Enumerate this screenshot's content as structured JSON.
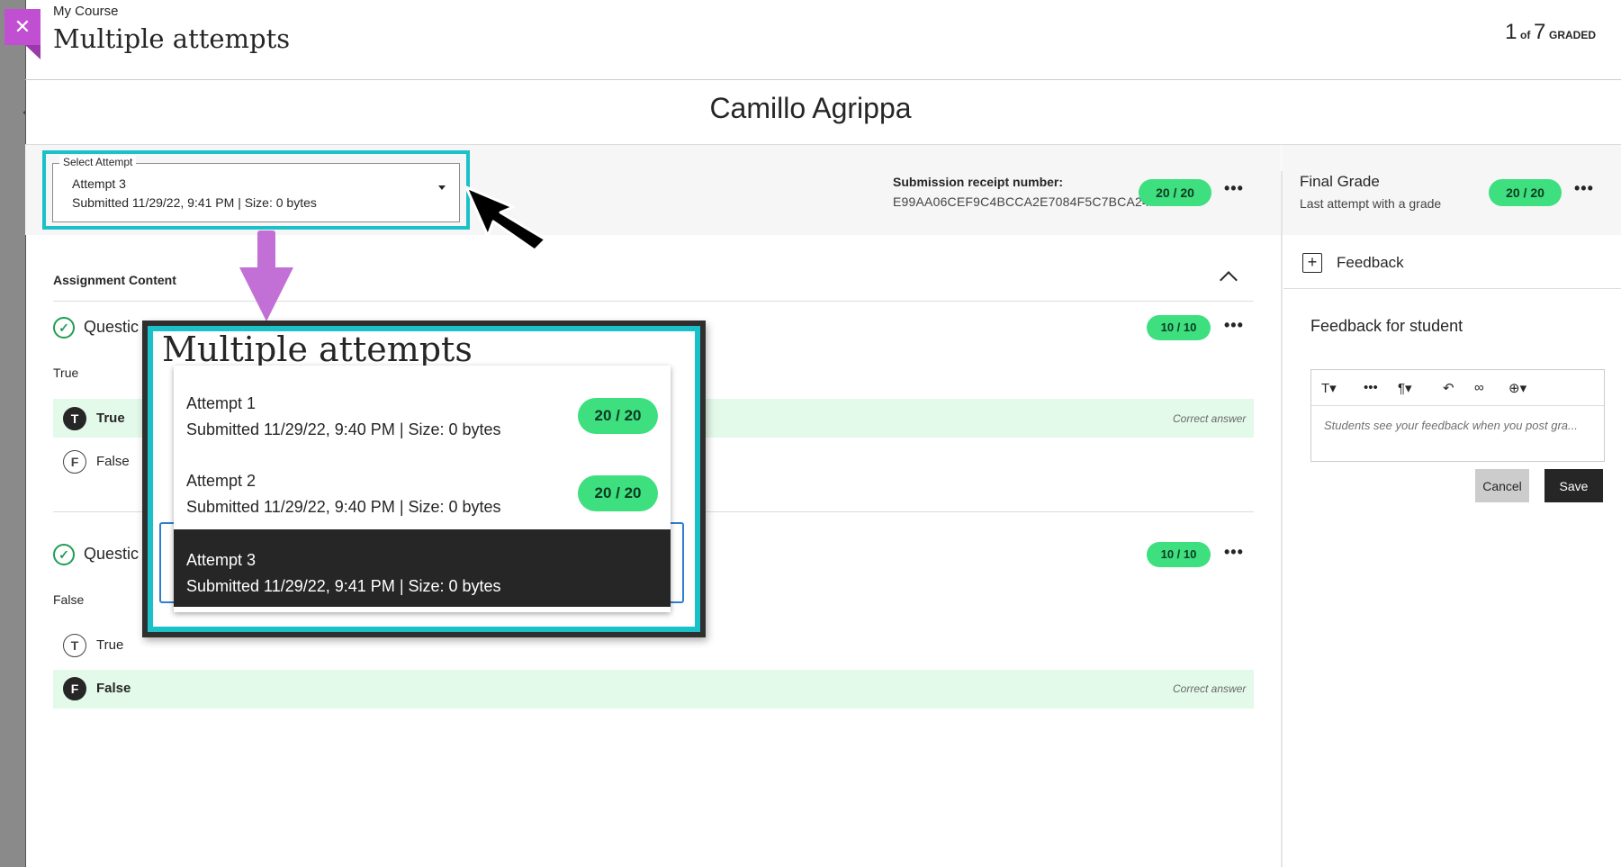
{
  "header": {
    "course_name": "My Course",
    "page_title": "Multiple attempts",
    "counter_current": "1",
    "counter_of": "of",
    "counter_total": "7",
    "counter_label": "GRADED",
    "close_glyph": "✕"
  },
  "student": {
    "name": "Camillo Agrippa"
  },
  "attempt_select": {
    "legend": "Select Attempt",
    "selected_name": "Attempt 3",
    "selected_meta": "Submitted 11/29/22, 9:41 PM | Size: 0 bytes"
  },
  "submission": {
    "receipt_label": "Submission receipt number:",
    "receipt_number": "E99AA06CEF9C4BCCA2E7084F5C7BCA24",
    "grade": "20 / 20",
    "more": "•••"
  },
  "final_grade": {
    "label": "Final Grade",
    "sub": "Last attempt with a grade",
    "grade": "20 / 20",
    "more": "•••"
  },
  "content": {
    "title": "Assignment Content",
    "questions": [
      {
        "title": "Questic",
        "grade": "10 / 10",
        "answer": "True",
        "options": [
          {
            "letter": "T",
            "label": "True",
            "correct_tag": "Correct answer"
          },
          {
            "letter": "F",
            "label": "False",
            "correct_tag": ""
          }
        ]
      },
      {
        "title": "Questic",
        "grade": "10 / 10",
        "answer": "False",
        "options": [
          {
            "letter": "T",
            "label": "True",
            "correct_tag": ""
          },
          {
            "letter": "F",
            "label": "False",
            "correct_tag": "Correct answer"
          }
        ]
      }
    ],
    "check_glyph": "✓",
    "more": "•••"
  },
  "feedback": {
    "tab_label": "Feedback",
    "title": "Feedback for student",
    "toolbar": [
      "T▾",
      "•••",
      "¶▾",
      "↶",
      "∞",
      "⊕▾"
    ],
    "placeholder": "Students see your feedback when you post gra...",
    "cancel_label": "Cancel",
    "save_label": "Save",
    "plus_glyph": "+"
  },
  "zoom": {
    "title": "Multiple attempts",
    "items": [
      {
        "name": "Attempt 1",
        "meta": "Submitted 11/29/22, 9:40 PM | Size: 0 bytes",
        "grade": "20 / 20"
      },
      {
        "name": "Attempt 2",
        "meta": "Submitted 11/29/22, 9:40 PM | Size: 0 bytes",
        "grade": "20 / 20"
      },
      {
        "name": "Attempt 3",
        "meta": "Submitted 11/29/22, 9:41 PM | Size: 0 bytes",
        "grade": ""
      }
    ]
  },
  "colors": {
    "accent_teal": "#1bc1c9",
    "grade_green": "#3ddf7f",
    "close_purple": "#c14fd1",
    "arrow_purple": "#c270d5",
    "correct_bg": "#e3f9ea"
  },
  "icons": [
    "close-icon",
    "chevron-up-icon",
    "check-circle-icon",
    "more-icon",
    "add-feedback-icon",
    "caret-down-icon",
    "cursor-icon",
    "down-arrow-icon"
  ]
}
